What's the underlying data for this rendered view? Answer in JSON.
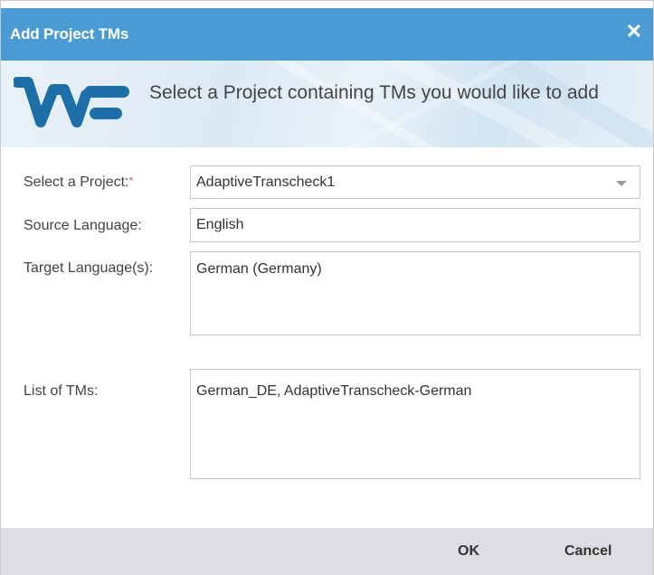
{
  "dialog": {
    "title": "Add Project TMs",
    "close_icon": "close-icon",
    "instruction": "Select a Project containing TMs you would like to add"
  },
  "form": {
    "project_label": "Select a Project:",
    "project_required_mark": "*",
    "project_value": "AdaptiveTranscheck1",
    "source_label": "Source Language:",
    "source_value": "English",
    "target_label": "Target Language(s):",
    "target_value": "German  (Germany)",
    "tms_label": "List of TMs:",
    "tms_value": "German_DE,  AdaptiveTranscheck-German"
  },
  "footer": {
    "ok_label": "OK",
    "cancel_label": "Cancel"
  },
  "colors": {
    "titlebar": "#4a9bd3",
    "logo": "#1d6fa8",
    "footer": "#dedee2",
    "required": "#d9534f"
  }
}
